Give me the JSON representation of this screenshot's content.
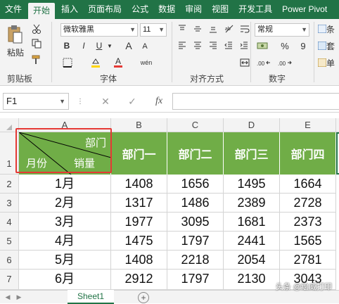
{
  "tabs": [
    "文件",
    "开始",
    "插入",
    "页面布局",
    "公式",
    "数据",
    "审阅",
    "视图",
    "开发工具",
    "Power Pivot"
  ],
  "active_tab": "开始",
  "ribbon": {
    "clipboard": {
      "paste_label": "粘贴",
      "group_label": "剪贴板"
    },
    "font": {
      "family": "微软雅黑",
      "size": "11",
      "group_label": "字体",
      "font_size_grow": "A",
      "font_size_shrink": "A",
      "bold": "B",
      "italic": "I",
      "underline": "U",
      "wen": "wén"
    },
    "alignment": {
      "group_label": "对齐方式"
    },
    "number": {
      "format": "常规",
      "percent": "%",
      "comma": "9",
      "group_label": "数字"
    },
    "styles": {
      "item1": "条",
      "item2": "套",
      "item3": "单"
    }
  },
  "formula_bar": {
    "name_box": "F1",
    "fx": "fx",
    "cancel": "✕",
    "enter": "✓",
    "formula": ""
  },
  "columns": [
    "A",
    "B",
    "C",
    "D",
    "E"
  ],
  "rows": [
    "1",
    "2",
    "3",
    "4",
    "5",
    "6",
    "7"
  ],
  "header_cell": {
    "top_right": "部门",
    "bottom_left": "月份",
    "bottom_mid": "销量"
  },
  "depts": [
    "部门一",
    "部门二",
    "部门三",
    "部门四"
  ],
  "months": [
    "1月",
    "2月",
    "3月",
    "4月",
    "5月",
    "6月"
  ],
  "table": [
    [
      "1408",
      "1656",
      "1495",
      "1664"
    ],
    [
      "1317",
      "1486",
      "2389",
      "2728"
    ],
    [
      "1977",
      "3095",
      "1681",
      "2373"
    ],
    [
      "1475",
      "1797",
      "2441",
      "1565"
    ],
    [
      "1408",
      "2218",
      "2054",
      "2781"
    ],
    [
      "2912",
      "1797",
      "2130",
      "3043"
    ]
  ],
  "sheet_tab": "Sheet1",
  "watermark": "头条 @绘威打印",
  "colors": {
    "brand": "#217346",
    "header_fill": "#70ad47",
    "highlight": "#e53935"
  }
}
